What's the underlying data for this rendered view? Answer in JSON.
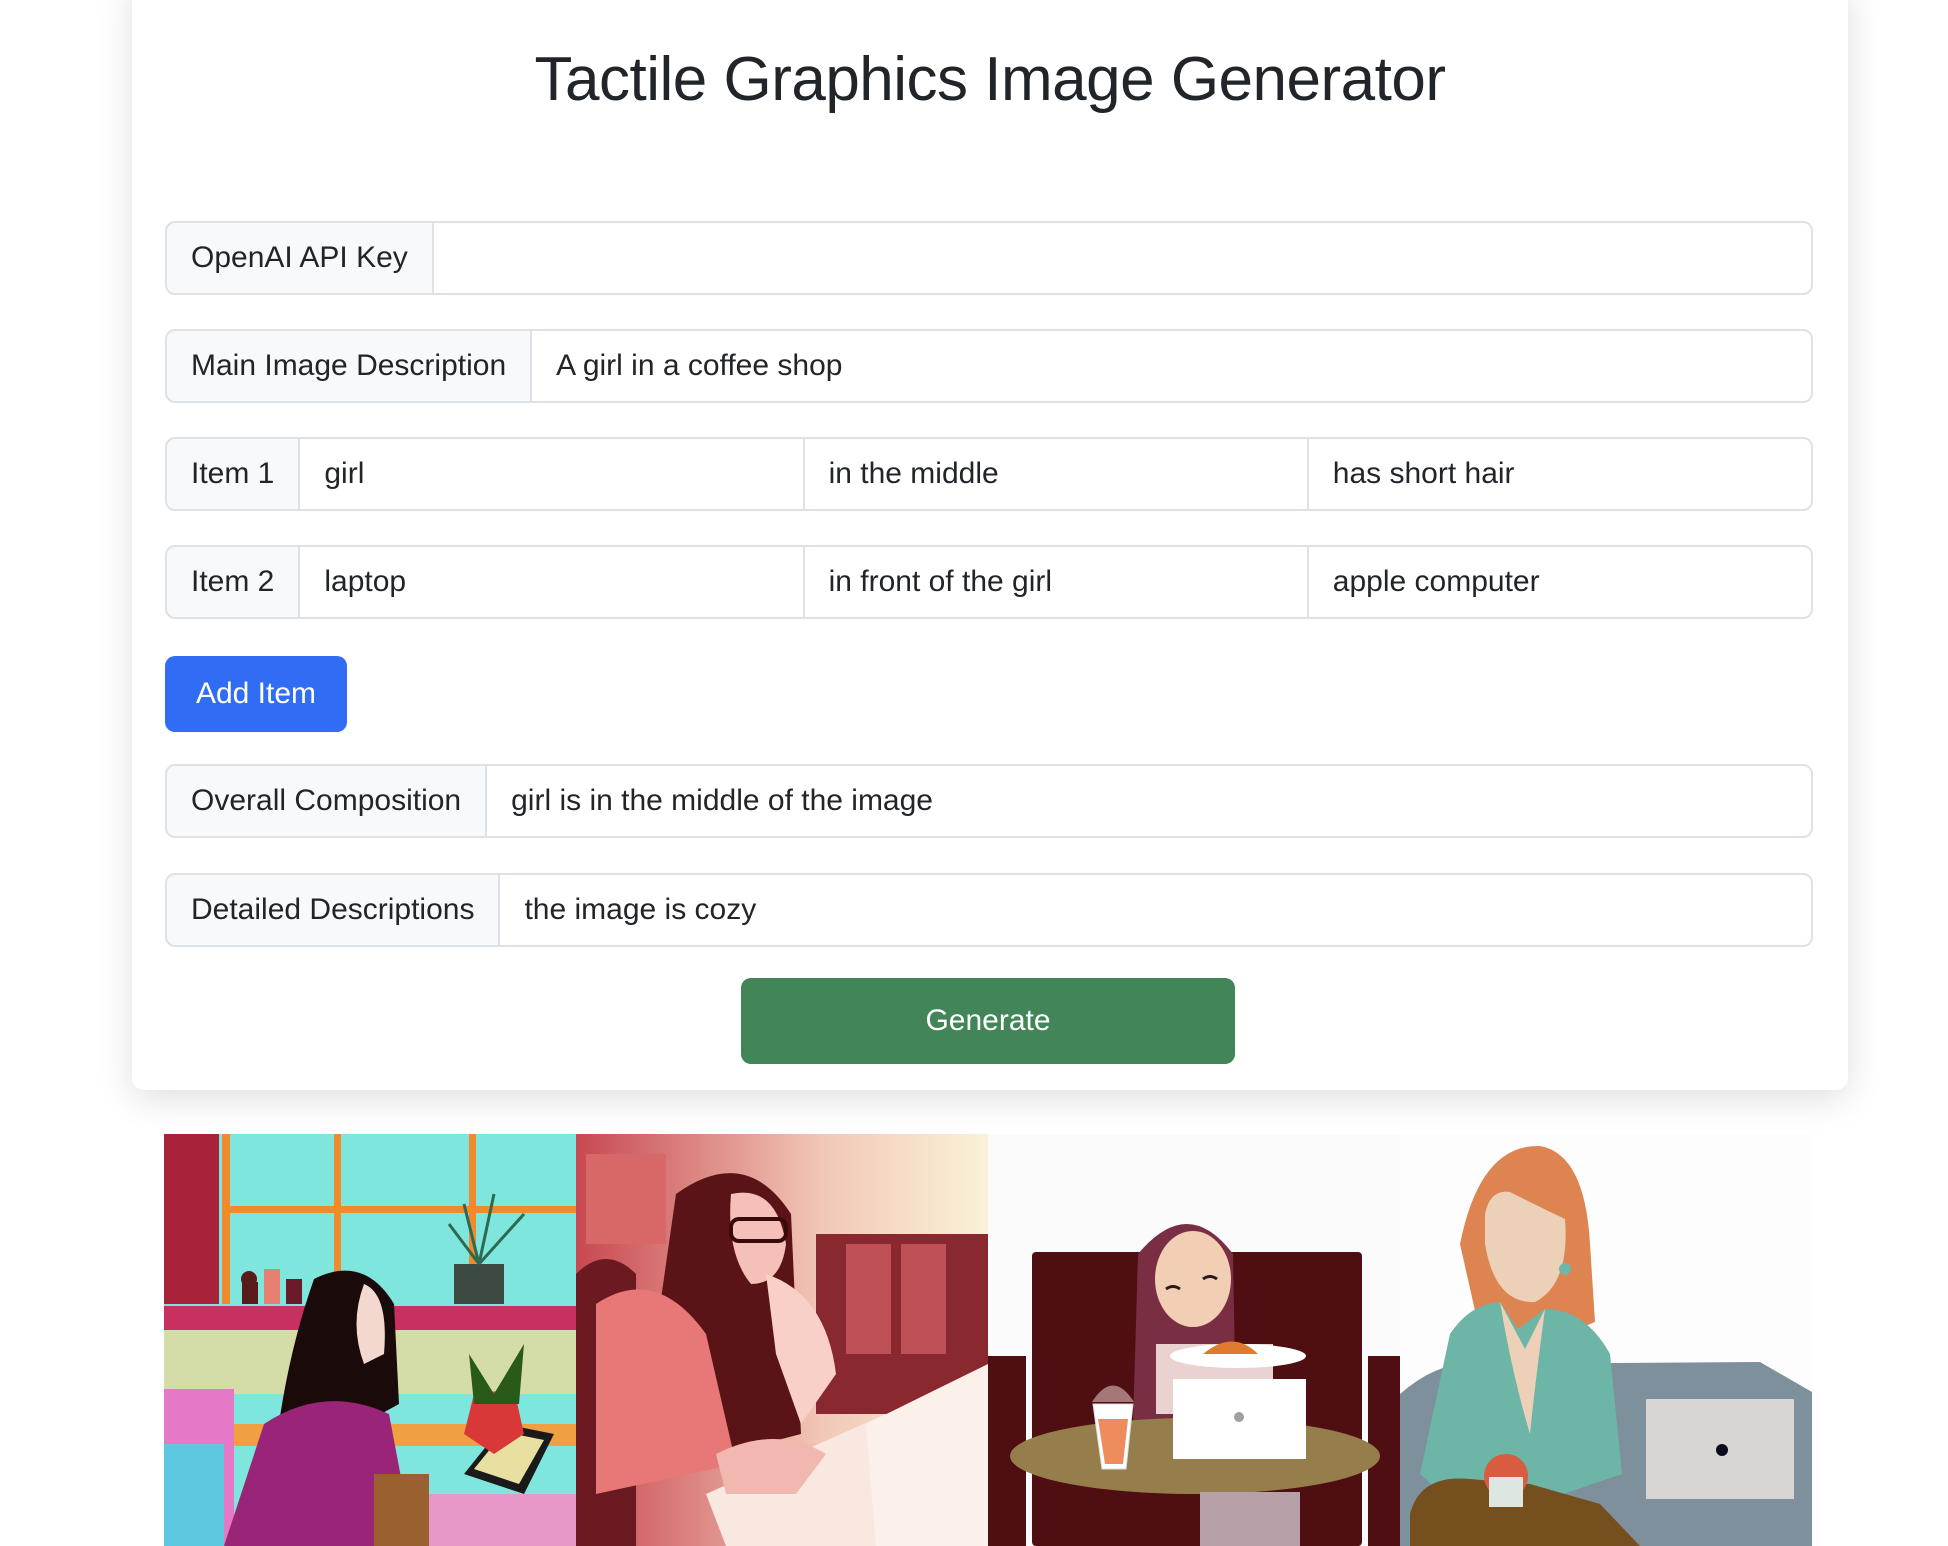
{
  "page": {
    "title": "Tactile Graphics Image Generator"
  },
  "form": {
    "api_key": {
      "label": "OpenAI API Key",
      "value": ""
    },
    "main_description": {
      "label": "Main Image Description",
      "value": "A girl in a coffee shop"
    },
    "items": [
      {
        "label": "Item 1",
        "name": "girl",
        "position": "in the middle",
        "detail": "has short hair"
      },
      {
        "label": "Item 2",
        "name": "laptop",
        "position": "in front of the girl",
        "detail": "apple computer"
      }
    ],
    "add_item_label": "Add Item",
    "overall_composition": {
      "label": "Overall Composition",
      "value": "girl is in the middle of the image"
    },
    "detailed_descriptions": {
      "label": "Detailed Descriptions",
      "value": "the image is cozy"
    },
    "generate_label": "Generate"
  },
  "results": {
    "images": [
      {
        "alt": "Colorful illustration of a long-haired girl in a coffee shop with a laptop"
      },
      {
        "alt": "Red-toned photo-like image of a girl with glasses using a laptop on a booth"
      },
      {
        "alt": "Flat illustration of a smiling girl at a round table with a laptop and drink"
      },
      {
        "alt": "Flat illustration of a red-haired woman holding a cup beside a laptop"
      }
    ]
  },
  "colors": {
    "primary": "#316df4",
    "success": "#418558",
    "label_bg": "#f8f9fa",
    "border": "#dee2e6",
    "text": "#212529"
  }
}
